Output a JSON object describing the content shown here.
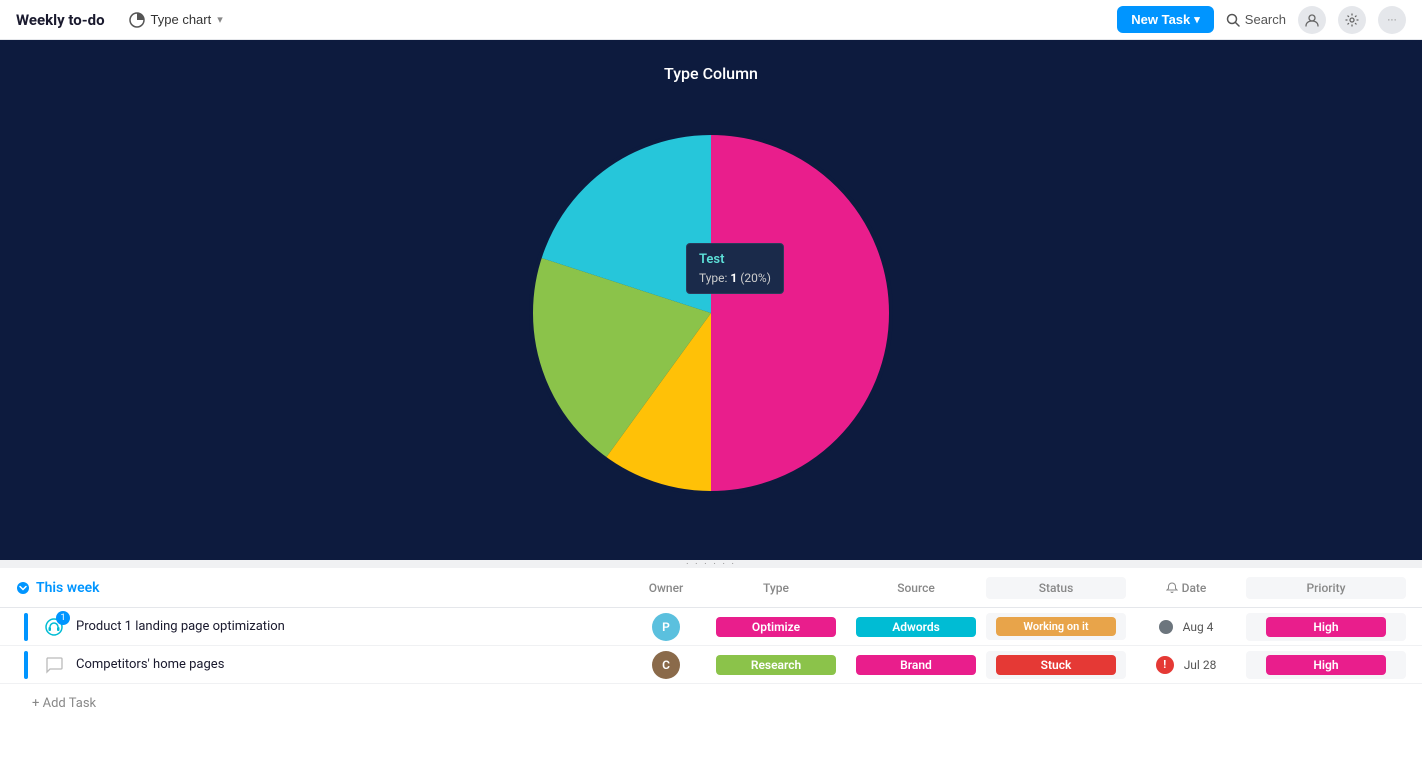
{
  "header": {
    "title": "Weekly to-do",
    "type_chart_label": "Type chart",
    "new_task_label": "New Task",
    "search_label": "Search",
    "chevron": "▾"
  },
  "chart": {
    "title": "Type Column",
    "tooltip": {
      "label": "Test",
      "value_text": "Type:",
      "value": "1",
      "percent": "20%"
    },
    "segments": [
      {
        "label": "Hot pink / main",
        "color": "#e91e8c",
        "startAngle": -90,
        "endAngle": 90
      },
      {
        "label": "Cyan",
        "color": "#26c6da",
        "startAngle": -90,
        "endAngle": -18
      },
      {
        "label": "Yellow-green",
        "color": "#8bc34a",
        "startAngle": -18,
        "endAngle": 54
      },
      {
        "label": "Yellow",
        "color": "#ffc107",
        "startAngle": 54,
        "endAngle": 90
      }
    ]
  },
  "table": {
    "section_label": "This week",
    "col_owner": "Owner",
    "col_type": "Type",
    "col_source": "Source",
    "col_status": "Status",
    "col_date": "Date",
    "col_priority": "Priority",
    "rows": [
      {
        "name": "Product 1 landing page optimization",
        "type": "Optimize",
        "source": "Adwords",
        "status": "Working on it",
        "date": "Aug 4",
        "priority": "High",
        "has_comment_badge": true,
        "badge_count": "1"
      },
      {
        "name": "Competitors' home pages",
        "type": "Research",
        "source": "Brand",
        "status": "Stuck",
        "date": "Jul 28",
        "priority": "High",
        "has_comment_badge": false,
        "badge_count": ""
      }
    ],
    "add_task_label": "+ Add Task"
  }
}
